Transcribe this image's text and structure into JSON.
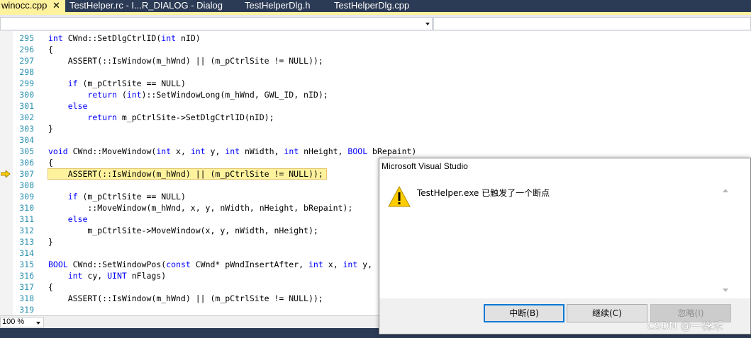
{
  "tabs": [
    {
      "label": "winocc.cpp",
      "close": "✕"
    },
    {
      "label": "TestHelper.rc - I...R_DIALOG - Dialog"
    },
    {
      "label": "TestHelperDlg.h"
    },
    {
      "label": "TestHelperDlg.cpp"
    }
  ],
  "code_lines": [
    {
      "n": "295",
      "text": "int CWnd::SetDlgCtrlID(int nID)"
    },
    {
      "n": "296",
      "text": "{"
    },
    {
      "n": "297",
      "text": "    ASSERT(::IsWindow(m_hWnd) || (m_pCtrlSite != NULL));"
    },
    {
      "n": "298",
      "text": ""
    },
    {
      "n": "299",
      "text": "    if (m_pCtrlSite == NULL)"
    },
    {
      "n": "300",
      "text": "        return (int)::SetWindowLong(m_hWnd, GWL_ID, nID);"
    },
    {
      "n": "301",
      "text": "    else"
    },
    {
      "n": "302",
      "text": "        return m_pCtrlSite->SetDlgCtrlID(nID);"
    },
    {
      "n": "303",
      "text": "}"
    },
    {
      "n": "304",
      "text": ""
    },
    {
      "n": "305",
      "text": "void CWnd::MoveWindow(int x, int y, int nWidth, int nHeight, BOOL bRepaint)"
    },
    {
      "n": "306",
      "text": "{"
    },
    {
      "n": "307",
      "text": "    ASSERT(::IsWindow(m_hWnd) || (m_pCtrlSite != NULL));"
    },
    {
      "n": "308",
      "text": ""
    },
    {
      "n": "309",
      "text": "    if (m_pCtrlSite == NULL)"
    },
    {
      "n": "310",
      "text": "        ::MoveWindow(m_hWnd, x, y, nWidth, nHeight, bRepaint);"
    },
    {
      "n": "311",
      "text": "    else"
    },
    {
      "n": "312",
      "text": "        m_pCtrlSite->MoveWindow(x, y, nWidth, nHeight);"
    },
    {
      "n": "313",
      "text": "}"
    },
    {
      "n": "314",
      "text": ""
    },
    {
      "n": "315",
      "text": "BOOL CWnd::SetWindowPos(const CWnd* pWndInsertAfter, int x, int y,"
    },
    {
      "n": "316",
      "text": "    int cy, UINT nFlags)"
    },
    {
      "n": "317",
      "text": "{"
    },
    {
      "n": "318",
      "text": "    ASSERT(::IsWindow(m_hWnd) || (m_pCtrlSite != NULL));"
    },
    {
      "n": "319",
      "text": ""
    }
  ],
  "current_line": "307",
  "zoom": "100 %",
  "dialog": {
    "title": "Microsoft Visual Studio",
    "message": "TestHelper.exe 已触发了一个断点",
    "buttons": [
      "中断(B)",
      "继续(C)",
      "忽略(I)"
    ]
  },
  "watermark": "CSDN @一株禾",
  "colors": {
    "tab_bar": "#2b3a55",
    "active_tab": "#fff29d",
    "current_line_highlight": "#fff29d",
    "line_number": "#2b91af",
    "keyword": "#0000ff",
    "breakpoint_arrow": "#ffcc00",
    "warning_icon": "#ffcc00",
    "primary_button_border": "#0078d7"
  },
  "icons": {
    "breakpoint_arrow": "current-statement-arrow-icon",
    "warning": "warning-icon",
    "tab_close": "close-icon"
  }
}
